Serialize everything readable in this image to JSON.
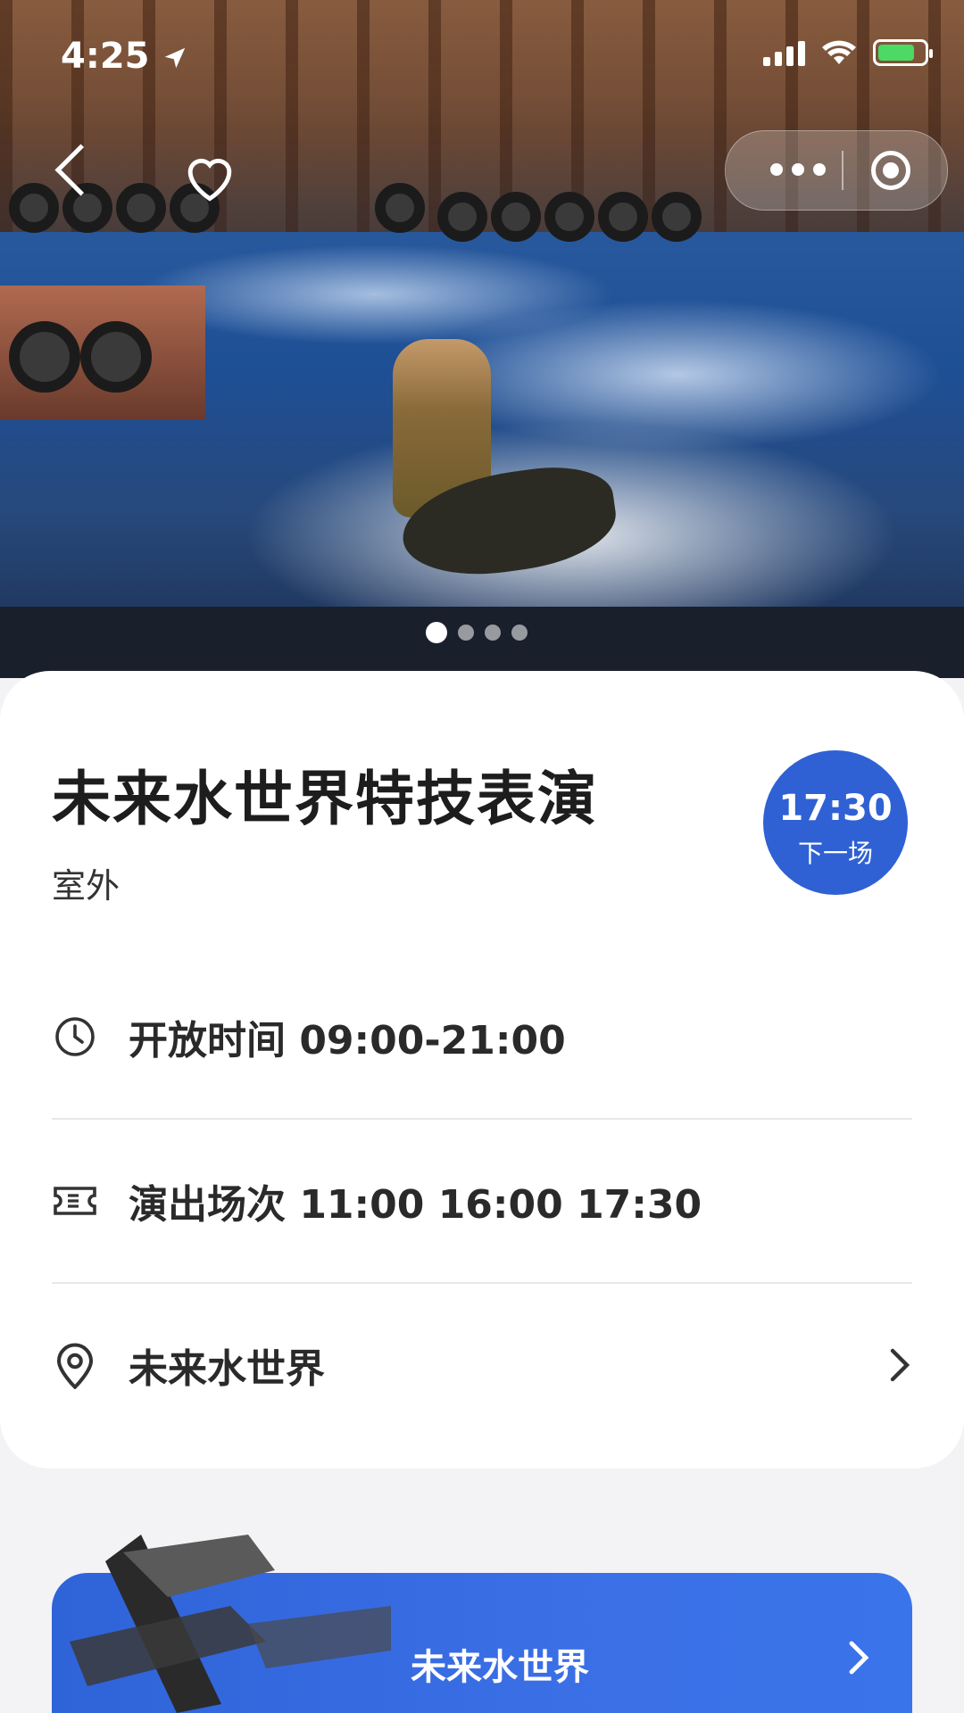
{
  "status_bar": {
    "time": "4:25"
  },
  "hero": {
    "image_description": "Jet-ski stunt rider on water in front of rusty industrial set",
    "pager_count": 4,
    "pager_active": 0
  },
  "show": {
    "title": "未来水世界特技表演",
    "location_type": "室外",
    "next_time": "17:30",
    "next_label": "下一场"
  },
  "info_rows": {
    "open_hours": "开放时间 09:00-21:00",
    "showtimes": "演出场次 11:00 16:00 17:30",
    "area": "未来水世界"
  },
  "promo": {
    "title": "未来水世界"
  },
  "colors": {
    "accent": "#2f61d4",
    "promo": "#3b6fe6",
    "battery": "#4cd964"
  },
  "icons": [
    "location-arrow-icon",
    "signal-icon",
    "wifi-icon",
    "battery-icon",
    "back-chevron-icon",
    "heart-icon",
    "more-dots-icon",
    "target-icon",
    "clock-icon",
    "ticket-icon",
    "map-pin-icon",
    "chevron-right-icon"
  ]
}
